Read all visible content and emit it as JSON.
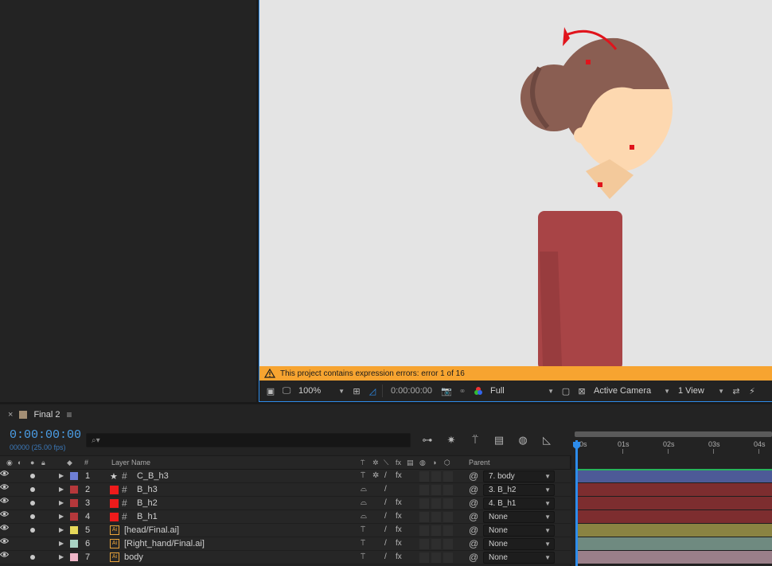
{
  "viewer": {
    "warning": "This project contains expression errors: error 1 of 16",
    "toolbar": {
      "zoom": "100%",
      "timecode": "0:00:00:00",
      "resolution": "Full",
      "camera": "Active Camera",
      "views": "1 View"
    }
  },
  "timeline": {
    "tab": {
      "close": "×",
      "name": "Final 2",
      "menu": "≡"
    },
    "timecode": "0:00:00:00",
    "frame_info": "00000 (25.00 fps)",
    "search_placeholder": "",
    "ruler": [
      "0s",
      "01s",
      "02s",
      "03s",
      "04s"
    ],
    "columns": {
      "hash": "#",
      "layer_name": "Layer Name",
      "parent": "Parent"
    },
    "layers": [
      {
        "num": "1",
        "name": "C_B_h3",
        "type": "null",
        "label_color": "#6f7fd6",
        "bar_color": "#4d5a97",
        "parent": "7. body",
        "solo": true,
        "fx": true
      },
      {
        "num": "2",
        "name": "B_h3",
        "type": "shape",
        "label_color": "#b5383b",
        "bar_color": "#7d2d2f",
        "parent": "3. B_h2",
        "solo": true,
        "fx": false
      },
      {
        "num": "3",
        "name": "B_h2",
        "type": "shape",
        "label_color": "#b5383b",
        "bar_color": "#7d2d2f",
        "parent": "4. B_h1",
        "solo": true,
        "fx": true
      },
      {
        "num": "4",
        "name": "B_h1",
        "type": "shape",
        "label_color": "#b5383b",
        "bar_color": "#7d2d2f",
        "parent": "None",
        "solo": true,
        "fx": true
      },
      {
        "num": "5",
        "name": "[head/Final.ai]",
        "type": "ai",
        "label_color": "#e6d85a",
        "bar_color": "#8a8342",
        "parent": "None",
        "solo": true,
        "fx": true
      },
      {
        "num": "6",
        "name": "[Right_hand/Final.ai]",
        "type": "ai",
        "label_color": "#a9d3c4",
        "bar_color": "#6f8a80",
        "parent": "None",
        "solo": false,
        "fx": true
      },
      {
        "num": "7",
        "name": "body",
        "type": "ai",
        "label_color": "#efb6c8",
        "bar_color": "#9a7f89",
        "parent": "None",
        "solo": true,
        "fx": true
      }
    ]
  }
}
